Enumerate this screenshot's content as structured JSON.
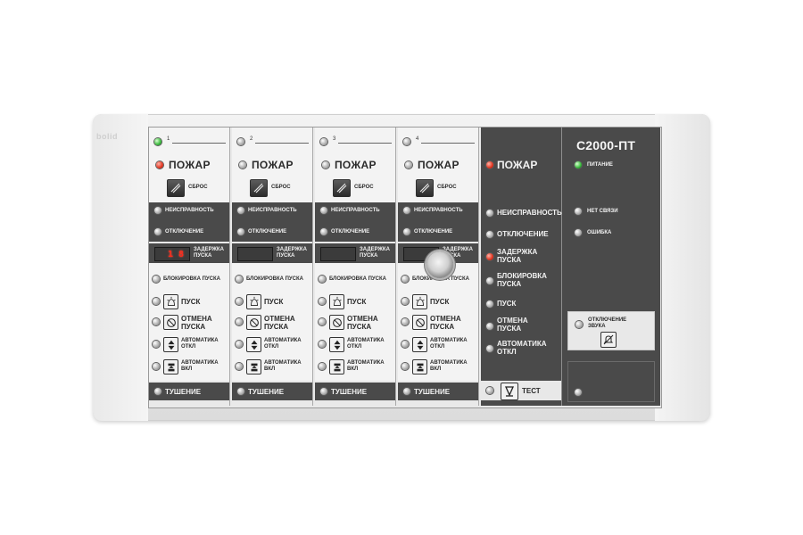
{
  "device": {
    "brand_mark": "bolid",
    "title": "С2000-ПТ"
  },
  "zones": [
    {
      "number": "1",
      "pozhar": "ПОЖАР",
      "sbros": "СБРОС",
      "neispr": "НЕИСПРАВНОСТЬ",
      "otkl": "ОТКЛЮЧЕНИЕ",
      "zaderzhka": "ЗАДЕРЖКА\nПУСКА",
      "display": [
        "",
        "1",
        "8"
      ],
      "blok": "БЛОКИРОВКА ПУСКА",
      "pusk": "ПУСК",
      "otmena": "ОТМЕНА\nПУСКА",
      "avto_otkl": "АВТОМАТИКА\nОТКЛ",
      "avto_vkl": "АВТОМАТИКА\nВКЛ",
      "tushenie": "ТУШЕНИЕ"
    },
    {
      "number": "2",
      "pozhar": "ПОЖАР",
      "sbros": "СБРОС",
      "neispr": "НЕИСПРАВНОСТЬ",
      "otkl": "ОТКЛЮЧЕНИЕ",
      "zaderzhka": "ЗАДЕРЖКА\nПУСКА",
      "display": [
        "",
        "",
        ""
      ],
      "blok": "БЛОКИРОВКА ПУСКА",
      "pusk": "ПУСК",
      "otmena": "ОТМЕНА\nПУСКА",
      "avto_otkl": "АВТОМАТИКА\nОТКЛ",
      "avto_vkl": "АВТОМАТИКА\nВКЛ",
      "tushenie": "ТУШЕНИЕ"
    },
    {
      "number": "3",
      "pozhar": "ПОЖАР",
      "sbros": "СБРОС",
      "neispr": "НЕИСПРАВНОСТЬ",
      "otkl": "ОТКЛЮЧЕНИЕ",
      "zaderzhka": "ЗАДЕРЖКА\nПУСКА",
      "display": [
        "",
        "",
        ""
      ],
      "blok": "БЛОКИРОВКА ПУСКА",
      "pusk": "ПУСК",
      "otmena": "ОТМЕНА\nПУСКА",
      "avto_otkl": "АВТОМАТИКА\nОТКЛ",
      "avto_vkl": "АВТОМАТИКА\nВКЛ",
      "tushenie": "ТУШЕНИЕ"
    },
    {
      "number": "4",
      "pozhar": "ПОЖАР",
      "sbros": "СБРОС",
      "neispr": "НЕИСПРАВНОСТЬ",
      "otkl": "ОТКЛЮЧЕНИЕ",
      "zaderzhka": "ЗАДЕРЖКА\nПУСКА",
      "display": [
        "",
        "",
        ""
      ],
      "blok": "БЛОКИРОВКА ПУСКА",
      "pusk": "ПУСК",
      "otmena": "ОТМЕНА\nПУСКА",
      "avto_otkl": "АВТОМАТИКА\nОТКЛ",
      "avto_vkl": "АВТОМАТИКА\nВКЛ",
      "tushenie": "ТУШЕНИЕ"
    }
  ],
  "common": {
    "pozhar": "ПОЖАР",
    "neispr": "НЕИСПРАВНОСТЬ",
    "otkl": "ОТКЛЮЧЕНИЕ",
    "zaderzhka": "ЗАДЕРЖКА\nПУСКА",
    "blok": "БЛОКИРОВКА\nПУСКА",
    "pusk": "ПУСК",
    "otmena": "ОТМЕНА\nПУСКА",
    "avto_otkl": "АВТОМАТИКА\nОТКЛ",
    "test": "ТЕСТ"
  },
  "status": {
    "pitanie": "ПИТАНИЕ",
    "net_svyazi": "НЕТ СВЯЗИ",
    "oshibka": "ОШИБКА",
    "otkl_zvuka": "ОТКЛЮЧЕНИЕ\nЗВУКА"
  },
  "indicators": {
    "zone1_top": "green",
    "zone1_pozhar": "red",
    "common_pozhar": "red",
    "common_zaderzhka": "red",
    "pitanie": "green"
  },
  "colors": {
    "panel_dark": "#4a4a4a",
    "panel_light": "#f3f3f3",
    "alarm_led": "#e1341f",
    "ok_led": "#37b83a"
  }
}
